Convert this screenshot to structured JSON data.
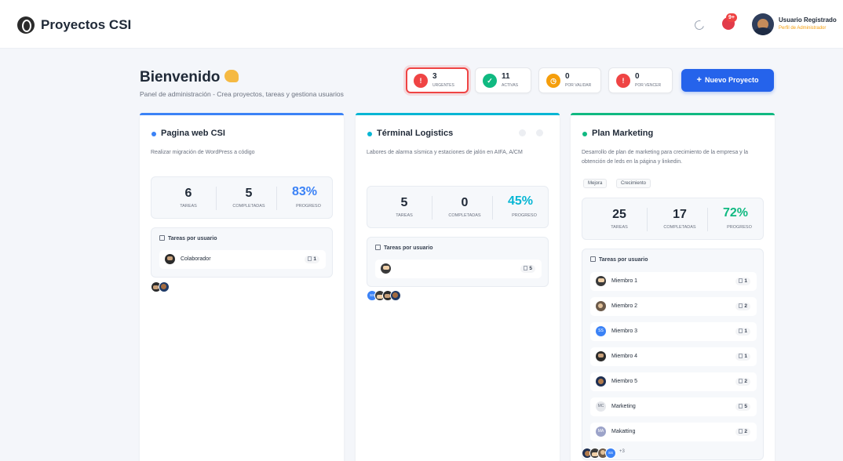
{
  "app": {
    "title": "Proyectos CSI"
  },
  "header": {
    "notification_badge": "9+",
    "user_name": "Usuario Registrado",
    "user_role": "Perfil de Administrador"
  },
  "welcome": {
    "title": "Bienvenido",
    "subtitle": "Panel de administración - Crea proyectos, tareas y gestiona usuarios"
  },
  "stats": [
    {
      "value": "3",
      "label": "URGENTES",
      "color": "#ef4444",
      "icon": "alert-triangle-icon"
    },
    {
      "value": "11",
      "label": "ACTIVAS",
      "color": "#10b981",
      "icon": "check-circle-icon"
    },
    {
      "value": "0",
      "label": "POR VALIDAR",
      "color": "#f59e0b",
      "icon": "clock-icon"
    },
    {
      "value": "0",
      "label": "POR VENCER",
      "color": "#ef4444",
      "icon": "alert-triangle-icon"
    }
  ],
  "new_project_label": "Nuevo Proyecto",
  "projects": [
    {
      "title": "Pagina web CSI",
      "accent": "#3b82f6",
      "description": "Realizar migración de WordPress a código",
      "tareas": "6",
      "completadas": "5",
      "progreso": "83%",
      "labels": {
        "tareas": "TAREAS",
        "completadas": "COMPLETADAS",
        "progreso": "PROGRESO"
      },
      "tasks_title": "Tareas por usuario",
      "users": [
        {
          "name": "Colaborador",
          "count": "1"
        }
      ]
    },
    {
      "title": "Términal Logistics",
      "accent": "#06b6d4",
      "description": "Labores de alarma sísmica y estaciones de jalón en AIFA, A/CM",
      "tareas": "5",
      "completadas": "0",
      "progreso": "45%",
      "labels": {
        "tareas": "TAREAS",
        "completadas": "COMPLETADAS",
        "progreso": "PROGRESO"
      },
      "tasks_title": "Tareas por usuario",
      "users": [
        {
          "name": "",
          "count": "5"
        }
      ],
      "avatar_initials": "SS"
    },
    {
      "title": "Plan Marketing",
      "accent": "#10b981",
      "description": "Desarrollo de plan de marketing para crecimiento de la empresa y la obtención de leds en la página y linkedin.",
      "tags": [
        "Mejora",
        "Crecimiento"
      ],
      "tareas": "25",
      "completadas": "17",
      "progreso": "72%",
      "labels": {
        "tareas": "TAREAS",
        "completadas": "COMPLETADAS",
        "progreso": "PROGRESO"
      },
      "tasks_title": "Tareas por usuario",
      "users": [
        {
          "name": "Miembro 1",
          "count": "1"
        },
        {
          "name": "Miembro 2",
          "count": "2"
        },
        {
          "name": "Miembro 3",
          "count": "1",
          "initials": "SS"
        },
        {
          "name": "Miembro 4",
          "count": "1"
        },
        {
          "name": "Miembro 5",
          "count": "2"
        },
        {
          "name": "Marketing",
          "count": "5",
          "initials": "MC"
        },
        {
          "name": "Makatting",
          "count": "2",
          "initials": "MA"
        }
      ],
      "avatar_initials": "SS",
      "more_avatars": "+3"
    }
  ]
}
